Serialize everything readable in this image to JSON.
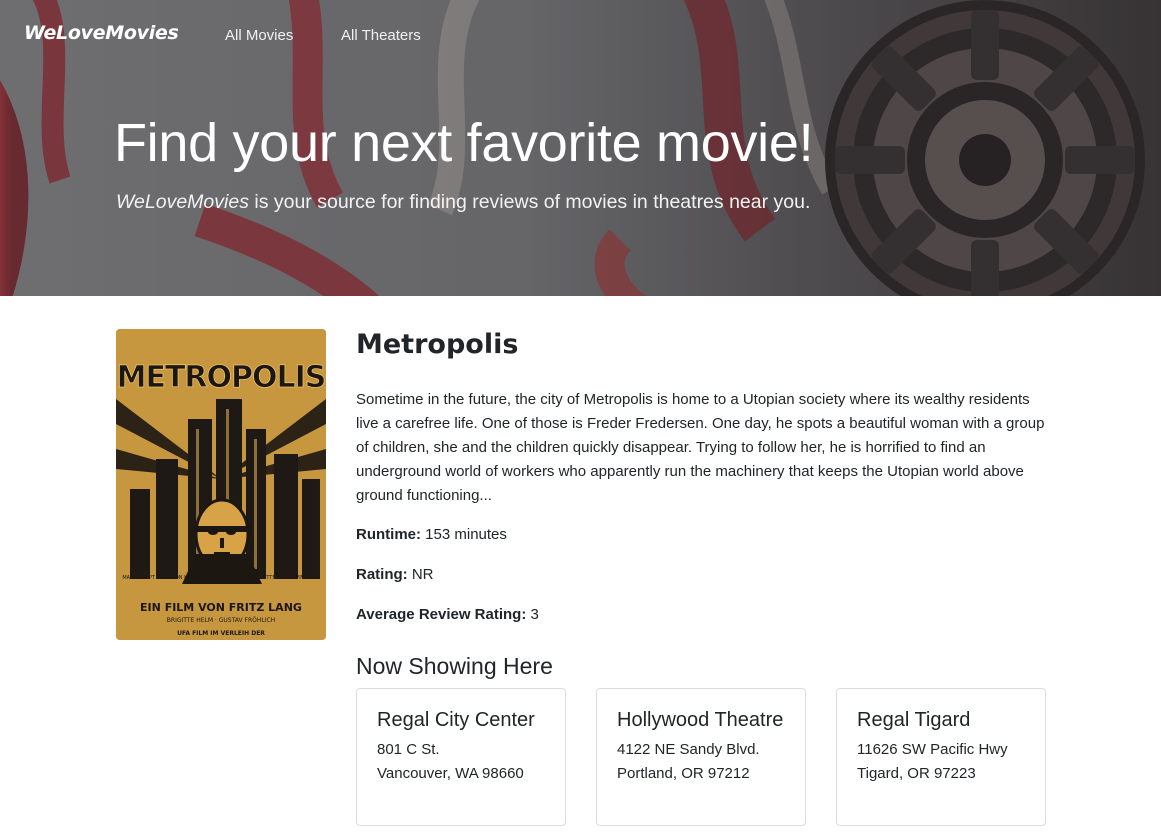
{
  "navbar": {
    "brand": "WeLoveMovies",
    "links": [
      "All Movies",
      "All Theaters"
    ]
  },
  "hero": {
    "title": "Find your next favorite movie!",
    "subtitle_brand": "WeLoveMovies",
    "subtitle_rest": " is your source for finding reviews of movies in theatres near you."
  },
  "movie": {
    "title": "Metropolis",
    "poster_alt": "Metropolis poster",
    "poster_text": {
      "wordmark": "METROPOLIS",
      "credit_left": "MANUSKRIPT THEA VON HARBOU",
      "credit_right": "MUSIK GOTTFRIED HUPPERTZ",
      "tagline": "EIN FILM VON FRITZ LANG",
      "cast": "BRIGITTE HELM · GUSTAV FRÖHLICH",
      "studio": "UFA FILM IM VERLEIH DER"
    },
    "description": "Sometime in the future, the city of Metropolis is home to a Utopian society where its wealthy residents live a carefree life. One of those is Freder Fredersen. One day, he spots a beautiful woman with a group of children, she and the children quickly disappear. Trying to follow her, he is horrified to find an underground world of workers who apparently run the machinery that keeps the Utopian world above ground functioning...",
    "runtime_label": "Runtime:",
    "runtime_value": " 153 minutes",
    "rating_label": "Rating:",
    "rating_value": " NR",
    "avg_label": "Average Review Rating:",
    "avg_value": " 3"
  },
  "now_showing": {
    "heading": "Now Showing Here",
    "theaters": [
      {
        "name": "Regal City Center",
        "street": "801 C St.",
        "city": "Vancouver, WA 98660"
      },
      {
        "name": "Hollywood Theatre",
        "street": "4122 NE Sandy Blvd.",
        "city": "Portland, OR 97212"
      },
      {
        "name": "Regal Tigard",
        "street": "11626 SW Pacific Hwy",
        "city": "Tigard, OR 97223"
      }
    ]
  },
  "colors": {
    "film_red": "#b3262f",
    "poster_gold": "#c7973f",
    "text": "#212529"
  }
}
